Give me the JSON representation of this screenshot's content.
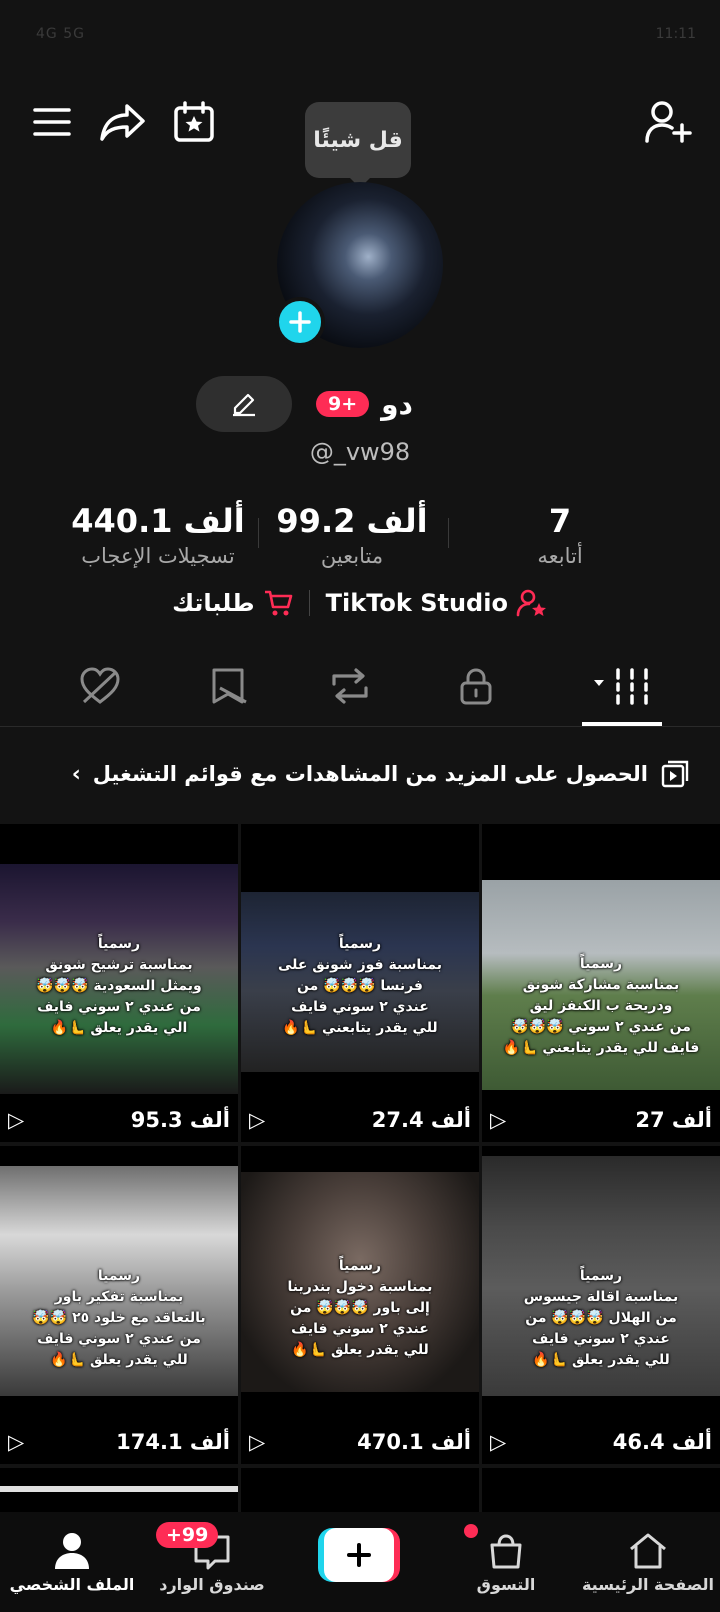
{
  "status": {
    "left": "4G 5G",
    "right": "11:11"
  },
  "tooltip": "قل شيئًا",
  "profile": {
    "name": "دو",
    "badge": "+9",
    "username": "@_vw98",
    "stats": [
      {
        "value": "7",
        "label": "أتابعه"
      },
      {
        "value": "99.2 ألف",
        "label": "متابعين"
      },
      {
        "value": "440.1 ألف",
        "label": "تسجيلات الإعجاب"
      }
    ],
    "studio_label": "TikTok Studio",
    "orders_label": "طلباتك"
  },
  "playlist_banner": "الحصول على المزيد من المشاهدات مع قوائم التشغيل",
  "videos": [
    {
      "views": "27 ألف",
      "caption": [
        "رسمياً",
        "بمناسبة مشاركة شونق",
        "ودريحة ب الكنفز ليق",
        "من عندي ٢ سوني 🤯🤯🤯",
        "فايف للي يقدر يتابعني 🫷🔥"
      ]
    },
    {
      "views": "27.4 ألف",
      "caption": [
        "رسمياً",
        "بمناسبة فوز شونق على",
        "فرنسا 🤯🤯🤯 من",
        "عندي ٢ سوني فايف",
        "للي يقدر يتابعني 🫷🔥"
      ]
    },
    {
      "views": "95.3 ألف",
      "caption": [
        "رسمياً",
        "بمناسبة ترشيح شونق",
        "ويمثل السعودية 🤯🤯🤯",
        "من عندي ٢ سوني فايف",
        "الي يقدر يعلق 🫷🔥"
      ]
    },
    {
      "views": "46.4 ألف",
      "caption": [
        "رسمياً",
        "بمناسبة اقالة جيسوس",
        "من الهلال 🤯🤯🤯 من",
        "عندي ٢ سوني فايف",
        "للي يقدر يعلق 🫷🔥"
      ]
    },
    {
      "views": "470.1 ألف",
      "caption": [
        "رسمياً",
        "بمناسبة دخول بندرينا",
        "إلى باور 🤯🤯🤯 من",
        "عندي ٢ سوني فايف",
        "للي يقدر يعلق 🫷🔥"
      ]
    },
    {
      "views": "174.1 ألف",
      "caption": [
        "رسميا",
        "بمناسبة تفكير باور",
        "بالتعاقد مع خلود ٢٥ 🤯🤯",
        "من عندي ٢ سوني فايف",
        "للي يقدر يعلق 🫷🔥"
      ]
    }
  ],
  "nav": {
    "home": "الصفحة الرئيسية",
    "shop": "التسوق",
    "inbox": "صندوق الوارد",
    "inbox_badge": "+99",
    "profile": "الملف الشخصي"
  },
  "colors": {
    "accent": "#fe2c55",
    "cyan": "#20d5ec",
    "bg": "#131313"
  }
}
